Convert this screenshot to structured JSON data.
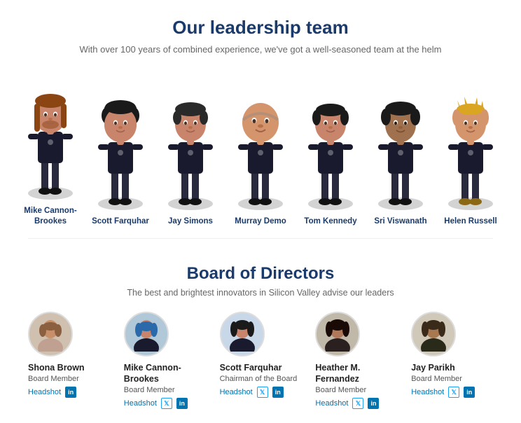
{
  "leadership": {
    "title": "Our leadership team",
    "subtitle": "With over 100 years of combined experience, we've got a well-seasoned team at the helm",
    "members": [
      {
        "name": "Mike Cannon-Brookes",
        "hairColor": "#8B4513",
        "skinColor": "#c8956c",
        "longHair": true
      },
      {
        "name": "Scott Farquhar",
        "hairColor": "#1a1a1a",
        "skinColor": "#c8956c",
        "longHair": false
      },
      {
        "name": "Jay Simons",
        "hairColor": "#1a1a1a",
        "skinColor": "#c8956c",
        "longHair": false
      },
      {
        "name": "Murray Demo",
        "hairColor": "#888",
        "skinColor": "#d4956c",
        "longHair": false,
        "bald": true
      },
      {
        "name": "Tom Kennedy",
        "hairColor": "#1a1a1a",
        "skinColor": "#c8956c",
        "longHair": false
      },
      {
        "name": "Sri Viswanath",
        "hairColor": "#1a1a1a",
        "skinColor": "#a0714f",
        "longHair": false
      },
      {
        "name": "Helen Russell",
        "hairColor": "#DAA520",
        "skinColor": "#d4956c",
        "longHair": false,
        "femaleHair": true
      }
    ]
  },
  "board": {
    "title": "Board of Directors",
    "subtitle": "The best and brightest innovators in Silicon Valley advise our leaders",
    "members": [
      {
        "name": "Shona Brown",
        "role": "Board Member",
        "headshot_label": "Headshot",
        "has_twitter": false,
        "has_linkedin": true,
        "avatar_emoji": "👩",
        "avatar_bg": "#d0c0b0"
      },
      {
        "name": "Mike Cannon-\nBrookes",
        "name_line1": "Mike Cannon-",
        "name_line2": "Brookes",
        "role": "Board Member",
        "headshot_label": "Headshot",
        "has_twitter": true,
        "has_linkedin": true,
        "avatar_emoji": "👨",
        "avatar_bg": "#b0c8d8"
      },
      {
        "name": "Scott Farquhar",
        "role": "Chairman of the Board",
        "headshot_label": "Headshot",
        "has_twitter": true,
        "has_linkedin": true,
        "avatar_emoji": "👨",
        "avatar_bg": "#c8d8e8"
      },
      {
        "name": "Heather M.\nFernandez",
        "name_line1": "Heather M.",
        "name_line2": "Fernandez",
        "role": "Board Member",
        "headshot_label": "Headshot",
        "has_twitter": true,
        "has_linkedin": true,
        "avatar_emoji": "👩",
        "avatar_bg": "#c0b8a8"
      },
      {
        "name": "Jay Parikh",
        "role": "Board Member",
        "headshot_label": "Headshot",
        "has_twitter": true,
        "has_linkedin": true,
        "avatar_emoji": "👨",
        "avatar_bg": "#d0c8b8"
      }
    ]
  }
}
